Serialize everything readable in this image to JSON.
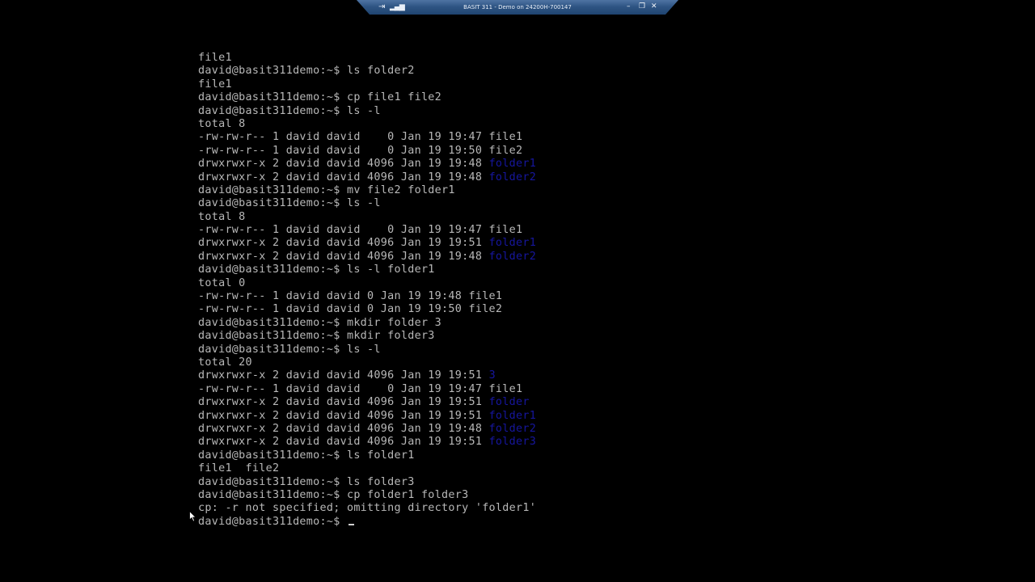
{
  "connection_bar": {
    "pin_icon": "pin-icon",
    "signal_icon": "signal-strength-icon",
    "title": "BASIT 311 - Demo on 24200H-700147",
    "minimize_icon": "minimize-icon",
    "restore_icon": "restore-icon",
    "close_icon": "close-icon"
  },
  "terminal": {
    "lines": [
      [
        {
          "t": "file1",
          "c": "text"
        }
      ],
      [
        {
          "t": "david@basit311demo:~$ ls folder2",
          "c": "text"
        }
      ],
      [
        {
          "t": "file1",
          "c": "text"
        }
      ],
      [
        {
          "t": "david@basit311demo:~$ cp file1 file2",
          "c": "text"
        }
      ],
      [
        {
          "t": "david@basit311demo:~$ ls -l",
          "c": "text"
        }
      ],
      [
        {
          "t": "total 8",
          "c": "text"
        }
      ],
      [
        {
          "t": "-rw-rw-r-- 1 david david    0 Jan 19 19:47 file1",
          "c": "text"
        }
      ],
      [
        {
          "t": "-rw-rw-r-- 1 david david    0 Jan 19 19:50 file2",
          "c": "text"
        }
      ],
      [
        {
          "t": "drwxrwxr-x 2 david david 4096 Jan 19 19:48 ",
          "c": "text"
        },
        {
          "t": "folder1",
          "c": "dir"
        }
      ],
      [
        {
          "t": "drwxrwxr-x 2 david david 4096 Jan 19 19:48 ",
          "c": "text"
        },
        {
          "t": "folder2",
          "c": "dir"
        }
      ],
      [
        {
          "t": "david@basit311demo:~$ mv file2 folder1",
          "c": "text"
        }
      ],
      [
        {
          "t": "david@basit311demo:~$ ls -l",
          "c": "text"
        }
      ],
      [
        {
          "t": "total 8",
          "c": "text"
        }
      ],
      [
        {
          "t": "-rw-rw-r-- 1 david david    0 Jan 19 19:47 file1",
          "c": "text"
        }
      ],
      [
        {
          "t": "drwxrwxr-x 2 david david 4096 Jan 19 19:51 ",
          "c": "text"
        },
        {
          "t": "folder1",
          "c": "dir"
        }
      ],
      [
        {
          "t": "drwxrwxr-x 2 david david 4096 Jan 19 19:48 ",
          "c": "text"
        },
        {
          "t": "folder2",
          "c": "dir"
        }
      ],
      [
        {
          "t": "david@basit311demo:~$ ls -l folder1",
          "c": "text"
        }
      ],
      [
        {
          "t": "total 0",
          "c": "text"
        }
      ],
      [
        {
          "t": "-rw-rw-r-- 1 david david 0 Jan 19 19:48 file1",
          "c": "text"
        }
      ],
      [
        {
          "t": "-rw-rw-r-- 1 david david 0 Jan 19 19:50 file2",
          "c": "text"
        }
      ],
      [
        {
          "t": "david@basit311demo:~$ mkdir folder 3",
          "c": "text"
        }
      ],
      [
        {
          "t": "david@basit311demo:~$ mkdir folder3",
          "c": "text"
        }
      ],
      [
        {
          "t": "david@basit311demo:~$ ls -l",
          "c": "text"
        }
      ],
      [
        {
          "t": "total 20",
          "c": "text"
        }
      ],
      [
        {
          "t": "drwxrwxr-x 2 david david 4096 Jan 19 19:51 ",
          "c": "text"
        },
        {
          "t": "3",
          "c": "dir"
        }
      ],
      [
        {
          "t": "-rw-rw-r-- 1 david david    0 Jan 19 19:47 file1",
          "c": "text"
        }
      ],
      [
        {
          "t": "drwxrwxr-x 2 david david 4096 Jan 19 19:51 ",
          "c": "text"
        },
        {
          "t": "folder",
          "c": "dir"
        }
      ],
      [
        {
          "t": "drwxrwxr-x 2 david david 4096 Jan 19 19:51 ",
          "c": "text"
        },
        {
          "t": "folder1",
          "c": "dir"
        }
      ],
      [
        {
          "t": "drwxrwxr-x 2 david david 4096 Jan 19 19:48 ",
          "c": "text"
        },
        {
          "t": "folder2",
          "c": "dir"
        }
      ],
      [
        {
          "t": "drwxrwxr-x 2 david david 4096 Jan 19 19:51 ",
          "c": "text"
        },
        {
          "t": "folder3",
          "c": "dir"
        }
      ],
      [
        {
          "t": "david@basit311demo:~$ ls folder1",
          "c": "text"
        }
      ],
      [
        {
          "t": "file1  file2",
          "c": "text"
        }
      ],
      [
        {
          "t": "david@basit311demo:~$ ls folder3",
          "c": "text"
        }
      ],
      [
        {
          "t": "david@basit311demo:~$ cp folder1 folder3",
          "c": "text"
        }
      ],
      [
        {
          "t": "cp: -r not specified; omitting directory 'folder1'",
          "c": "text"
        }
      ]
    ],
    "prompt": "david@basit311demo:~$ ",
    "cursor_icon": "text-cursor-icon",
    "mouse_pointer_icon": "mouse-pointer-icon"
  },
  "colors": {
    "background": "#000000",
    "text": "#b8b8b8",
    "directory": "#16169e",
    "bar_top": "#4f74a3",
    "bar_bottom": "#1f4470"
  }
}
